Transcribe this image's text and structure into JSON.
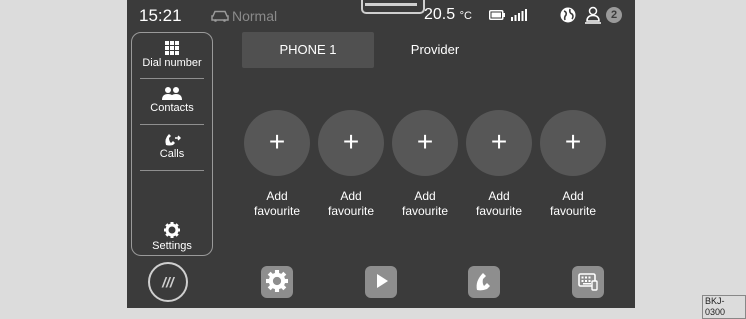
{
  "status_bar": {
    "time": "15:21",
    "mode": "Normal",
    "temperature": "20.5",
    "temperature_unit": "°C",
    "notification_count": "2"
  },
  "sidebar": {
    "items": [
      {
        "label": "Dial number",
        "icon": "keypad-icon"
      },
      {
        "label": "Contacts",
        "icon": "contacts-icon"
      },
      {
        "label": "Calls",
        "icon": "phone-calls-icon"
      },
      {
        "label": "Settings",
        "icon": "gear-icon"
      }
    ]
  },
  "tabs": [
    {
      "label": "PHONE 1",
      "selected": true
    },
    {
      "label": "Provider",
      "selected": false
    }
  ],
  "favourites": [
    {
      "plus": "+",
      "label": "Add\nfavourite"
    },
    {
      "plus": "+",
      "label": "Add\nfavourite"
    },
    {
      "plus": "+",
      "label": "Add\nfavourite"
    },
    {
      "plus": "+",
      "label": "Add\nfavourite"
    },
    {
      "plus": "+",
      "label": "Add\nfavourite"
    }
  ],
  "dock": {
    "main_label": "///",
    "buttons": [
      "gear-icon",
      "play-icon",
      "phone-icon",
      "keyboard-icon"
    ]
  },
  "figure_code": "BKJ-0300",
  "colors": {
    "screen_bg": "#3b3b3b",
    "favourite_circle": "#575757",
    "dock_button": "#8e8e8e"
  }
}
